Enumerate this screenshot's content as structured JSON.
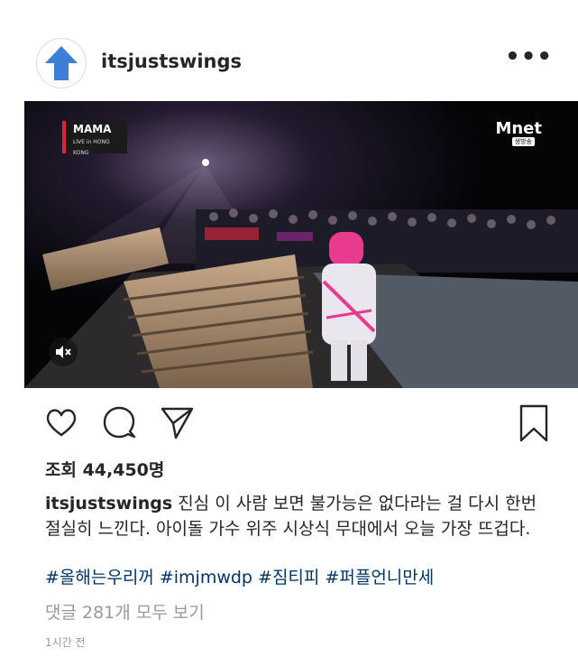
{
  "post": {
    "username": "itsjustswings",
    "more_label": "•••",
    "avatar_icon": "up-arrow-icon",
    "video": {
      "overlay_logo_left": "MAMA",
      "overlay_logo_left_sub": "LIVE in HONG KONG",
      "overlay_logo_right": "Mnet",
      "overlay_logo_right_sub": "생방송",
      "mute_icon": "speaker-muted-icon"
    },
    "actions": {
      "like_icon": "heart-icon",
      "comment_icon": "comment-icon",
      "share_icon": "paper-plane-icon",
      "save_icon": "bookmark-icon"
    },
    "views": "조회 44,450명",
    "caption_user": "itsjustswings",
    "caption_text": "진심 이 사람 보면 불가능은 없다라는 걸 다시 한번 절실히 느낀다. 아이돌 가수 위주 시상식 무대에서 오늘 가장 뜨겁다.",
    "hashtags": "#올해는우리꺼 #imjmwdp #짐티피 #퍼플언니만세",
    "comments_link": "댓글 281개 모두 보기",
    "timestamp": "1시간 전"
  },
  "colors": {
    "text": "#262626",
    "link": "#003569",
    "muted": "#999999",
    "avatar_arrow": "#3d7fd6"
  }
}
